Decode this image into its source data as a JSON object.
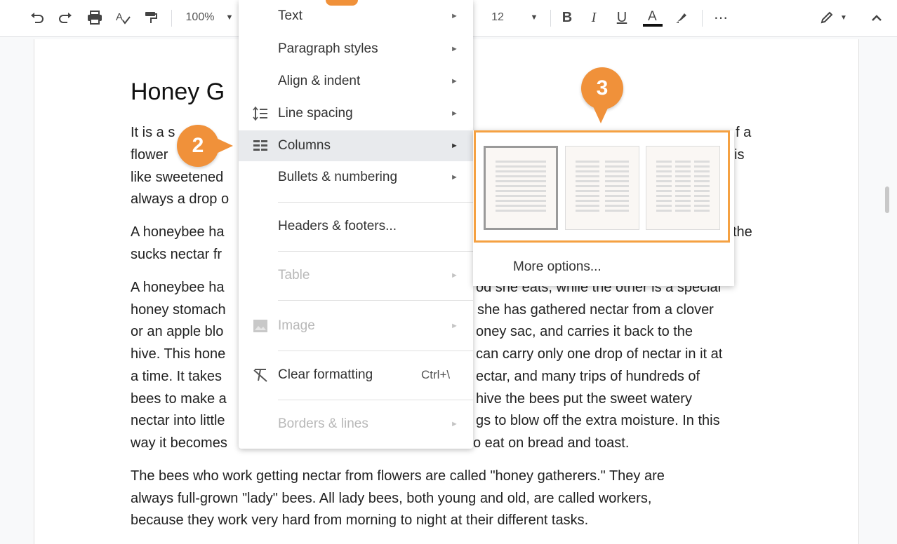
{
  "toolbar": {
    "zoom": "100%",
    "font_size": "12"
  },
  "document": {
    "title": "Honey G",
    "lines": [
      "It is a s",
      "flower",
      "like sweetened",
      "always a drop o",
      "A honeybee ha",
      "sucks nectar fr",
      "A honeybee ha",
      "honey stomach",
      "or an apple blo",
      "hive. This hone",
      "a time. It takes",
      "bees to make a",
      "nectar into little",
      "way it becomes",
      "The bees who work getting nectar from flowers are called \"honey gatherers.\" They are",
      "always full-grown \"lady\" bees. All lady bees, both young and old, are called workers,",
      "because they work very hard from morning to night at their different tasks."
    ],
    "right_fragments": [
      "f a",
      "is",
      "the",
      "od she eats, while the other is a special",
      "she has gathered nectar from a clover",
      "oney sac, and carries it back to the",
      "can carry only one drop of nectar in it at",
      "ectar, and many trips of hundreds of",
      "hive the bees put the sweet watery",
      "gs to blow off the extra moisture. In this",
      "o eat on bread and toast."
    ]
  },
  "format_menu": {
    "items": [
      {
        "label": "Text",
        "icon": "",
        "enabled": true
      },
      {
        "label": "Paragraph styles",
        "icon": "",
        "enabled": true
      },
      {
        "label": "Align & indent",
        "icon": "",
        "enabled": true
      },
      {
        "label": "Line spacing",
        "icon": "line-spacing-icon",
        "enabled": true
      },
      {
        "label": "Columns",
        "icon": "columns-icon",
        "enabled": true,
        "highlighted": true
      },
      {
        "label": "Bullets & numbering",
        "icon": "",
        "enabled": true
      },
      {
        "label": "Headers & footers...",
        "icon": "",
        "enabled": true
      },
      {
        "label": "Table",
        "icon": "",
        "enabled": false
      },
      {
        "label": "Image",
        "icon": "image-icon",
        "enabled": false
      },
      {
        "label": "Clear formatting",
        "icon": "clear-formatting-icon",
        "enabled": true,
        "shortcut": "Ctrl+\\"
      },
      {
        "label": "Borders & lines",
        "icon": "",
        "enabled": false
      }
    ]
  },
  "columns_submenu": {
    "presets": [
      "one-column",
      "two-columns",
      "three-columns"
    ],
    "selected": "one-column",
    "more_options": "More options..."
  },
  "callouts": [
    "2",
    "3"
  ],
  "colors": {
    "callout": "#f0913a",
    "highlight_border": "#f5a142"
  }
}
